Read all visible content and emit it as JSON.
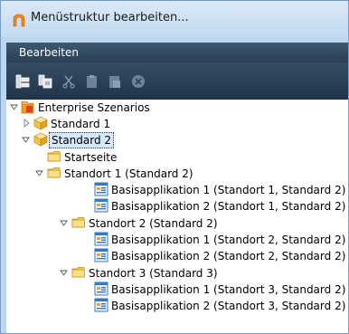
{
  "window": {
    "title": "Menüstruktur bearbeiten..."
  },
  "menu": {
    "items": [
      {
        "label": "Bearbeiten"
      }
    ]
  },
  "toolbar": {
    "buttons": [
      {
        "icon": "add-child-node-icon",
        "enabled": true
      },
      {
        "icon": "copy-node-icon",
        "enabled": true
      },
      {
        "icon": "cut-icon",
        "enabled": false
      },
      {
        "icon": "paste-icon",
        "enabled": false
      },
      {
        "icon": "paste-into-icon",
        "enabled": false
      },
      {
        "icon": "delete-icon",
        "enabled": false
      }
    ]
  },
  "tree": {
    "root": {
      "label": "Enterprise Szenarios",
      "icon": "enterprise-root-icon",
      "expanded": true
    },
    "standard1": {
      "label": "Standard 1",
      "icon": "standard-cube-icon",
      "expanded": false
    },
    "standard2": {
      "label": "Standard 2",
      "icon": "standard-cube-icon",
      "expanded": true,
      "selected": true
    },
    "startseite": {
      "label": "Startseite",
      "icon": "folder-icon"
    },
    "standort1": {
      "label": "Standort 1 (Standard 2)",
      "icon": "folder-icon",
      "expanded": true
    },
    "s1app1": {
      "label": "Basisapplikation 1 (Standort 1, Standard 2)",
      "icon": "application-icon"
    },
    "s1app2": {
      "label": "Basisapplikation 2 (Standort 1, Standard 2)",
      "icon": "application-icon"
    },
    "standort2": {
      "label": "Standort 2 (Standard 2)",
      "icon": "folder-icon",
      "expanded": true
    },
    "s2app1": {
      "label": "Basisapplikation 1 (Standort 2, Standard 2)",
      "icon": "application-icon"
    },
    "s2app2": {
      "label": "Basisapplikation 2 (Standort 2, Standard 2)",
      "icon": "application-icon"
    },
    "standort3": {
      "label": "Standort 3 (Standard 3)",
      "icon": "folder-icon",
      "expanded": true
    },
    "s3app1": {
      "label": "Basisapplikation 1 (Standort 3, Standard 2)",
      "icon": "application-icon"
    },
    "s3app2": {
      "label": "Basisapplikation 2 (Standort 3, Standard 2)",
      "icon": "application-icon"
    }
  },
  "colors": {
    "titlebar": "#c9ddf2",
    "menubar": "#34495e",
    "toolbar": "#2c4157",
    "folder": "#f5c74a",
    "selection": "#d6e8fb"
  }
}
